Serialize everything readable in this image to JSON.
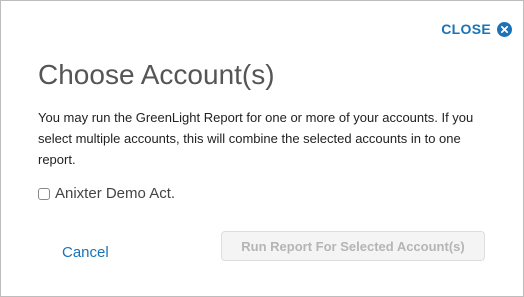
{
  "dialog": {
    "close_label": "CLOSE",
    "close_icon": "close-circle-icon",
    "title": "Choose Account(s)",
    "description": "You may run the GreenLight Report for one or more of your accounts. If you select multiple accounts, this will combine the selected accounts in to one report.",
    "accounts": [
      {
        "label": "Anixter Demo Act.",
        "checked": false
      }
    ],
    "cancel_label": "Cancel",
    "run_label": "Run Report For Selected Account(s)",
    "run_enabled": false
  },
  "colors": {
    "accent": "#1a73b8",
    "title": "#555555",
    "disabled_text": "#b5b5b5",
    "disabled_bg": "#f4f4f4"
  }
}
